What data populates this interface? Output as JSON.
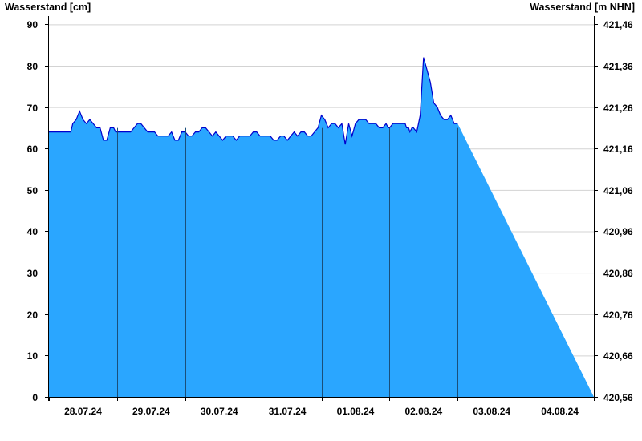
{
  "chart_data": {
    "type": "area",
    "left_axis_title": "Wasserstand [cm]",
    "right_axis_title": "Wasserstand [m NHN]",
    "ylim": [
      0,
      92
    ],
    "left_ticks": [
      0,
      10,
      20,
      30,
      40,
      50,
      60,
      70,
      80,
      90
    ],
    "right_ticks": [
      "420,56",
      "420,66",
      "420,76",
      "420,86",
      "420,96",
      "421,06",
      "421,16",
      "421,26",
      "421,36",
      "421,46"
    ],
    "x_labels": [
      "28.07.24",
      "29.07.24",
      "30.07.24",
      "31.07.24",
      "01.08.24",
      "02.08.24",
      "03.08.24",
      "04.08.24"
    ],
    "grid": true,
    "colors": {
      "fill": "#2aa6ff",
      "line": "#0000cc",
      "grid": "#d3d3d3",
      "day_divider": "#1a4f7a"
    },
    "series": [
      {
        "x_days": [
          0,
          0.32,
          0.35,
          0.4,
          0.45,
          0.5,
          0.55,
          0.6,
          0.65,
          0.7,
          0.72,
          0.75,
          0.8,
          0.85,
          0.9,
          0.95,
          0.98,
          1.02,
          1.1,
          1.15,
          1.2,
          1.25,
          1.3,
          1.35,
          1.4,
          1.45,
          1.5,
          1.55,
          1.6,
          1.65,
          1.7,
          1.75,
          1.8,
          1.85,
          1.9,
          1.95,
          2.0,
          2.05,
          2.1,
          2.15,
          2.2,
          2.25,
          2.3,
          2.35,
          2.4,
          2.45,
          2.5,
          2.55,
          2.6,
          2.65,
          2.7,
          2.75,
          2.8,
          2.85,
          2.9,
          2.95,
          3.0,
          3.05,
          3.1,
          3.15,
          3.2,
          3.25,
          3.3,
          3.35,
          3.4,
          3.45,
          3.5,
          3.55,
          3.6,
          3.65,
          3.7,
          3.75,
          3.8,
          3.85,
          3.9,
          3.95,
          4.0,
          4.05,
          4.1,
          4.15,
          4.2,
          4.25,
          4.3,
          4.35,
          4.4,
          4.45,
          4.5,
          4.55,
          4.6,
          4.65,
          4.7,
          4.75,
          4.8,
          4.85,
          4.9,
          4.95,
          4.98,
          5.0,
          5.05,
          5.1,
          5.15,
          5.2,
          5.23,
          5.25,
          5.28,
          5.3,
          5.33,
          5.35,
          5.4,
          5.45,
          5.5,
          5.55,
          5.6,
          5.65,
          5.7,
          5.75,
          5.8,
          5.85,
          5.9,
          5.95,
          6.0,
          6.05,
          6.1,
          6.15,
          6.2,
          6.25,
          6.3,
          6.35,
          6.4,
          6.45,
          6.5,
          6.55,
          6.6,
          6.65,
          6.7,
          6.75,
          6.8,
          6.85,
          6.9,
          6.95,
          7.0,
          7.05,
          7.1,
          7.15,
          7.2,
          7.25,
          7.28,
          7.32,
          7.35,
          7.38,
          7.4,
          7.42,
          7.45,
          7.5,
          7.55,
          7.6,
          7.65,
          7.7,
          7.75,
          7.8,
          7.85,
          7.9,
          7.95,
          8.0
        ],
        "values": [
          64,
          64,
          66,
          67,
          69,
          67,
          66,
          67,
          66,
          65,
          65,
          65,
          62,
          62,
          65,
          65,
          64,
          64,
          64,
          64,
          64,
          65,
          66,
          66,
          65,
          64,
          64,
          64,
          63,
          63,
          63,
          63,
          64,
          62,
          62,
          64,
          64,
          63,
          63,
          64,
          64,
          65,
          65,
          64,
          63,
          64,
          63,
          62,
          63,
          63,
          63,
          62,
          63,
          63,
          63,
          63,
          64,
          64,
          63,
          63,
          63,
          63,
          62,
          62,
          63,
          63,
          62,
          63,
          64,
          63,
          64,
          64,
          63,
          63,
          64,
          65,
          68,
          67,
          65,
          66,
          66,
          65,
          66,
          61,
          66,
          63,
          66,
          67,
          67,
          67,
          66,
          66,
          66,
          65,
          65,
          66,
          65,
          65,
          66,
          66,
          66,
          66,
          66,
          65,
          65,
          64,
          65,
          65,
          64,
          68,
          82,
          79,
          76,
          71,
          70,
          68,
          67,
          67,
          68,
          66,
          66
        ],
        "values_note": ""
      }
    ]
  }
}
